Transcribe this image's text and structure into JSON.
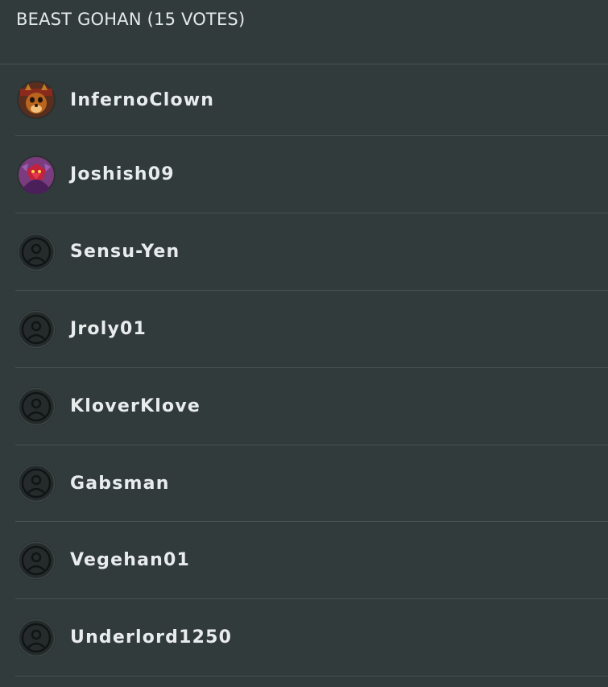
{
  "header": {
    "title": "BEAST GOHAN (15 VOTES)"
  },
  "voters": [
    {
      "name": "InfernoClown",
      "avatar": "custom-avatar-fox-icon"
    },
    {
      "name": "Joshish09",
      "avatar": "custom-avatar-character-icon"
    },
    {
      "name": "Sensu-Yen",
      "avatar": "default-user-avatar-icon"
    },
    {
      "name": "Jroly01",
      "avatar": "default-user-avatar-icon"
    },
    {
      "name": "KloverKlove",
      "avatar": "default-user-avatar-icon"
    },
    {
      "name": "Gabsman",
      "avatar": "default-user-avatar-icon"
    },
    {
      "name": "Vegehan01",
      "avatar": "default-user-avatar-icon"
    },
    {
      "name": "Underlord1250",
      "avatar": "default-user-avatar-icon"
    }
  ],
  "colors": {
    "background": "#323b3b",
    "divider": "#485252",
    "text": "#e9ecec"
  }
}
